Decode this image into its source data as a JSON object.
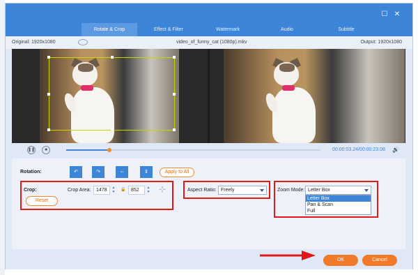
{
  "tabs": [
    "Rotate & Crop",
    "Effect & Filter",
    "Watermark",
    "Audio",
    "Subtitle"
  ],
  "window": {
    "minimize_icon": "square-icon",
    "close_icon": "close-icon"
  },
  "info": {
    "original": "Original: 1920x1080",
    "filename": "video_of_funny_cat (1080p).mkv",
    "output": "Output: 1920x1080"
  },
  "player": {
    "time": "00:00:03.24/00:00:23.08",
    "progress_fraction": 0.17
  },
  "rotation": {
    "label": "Rotation:",
    "apply_all": "Apply to All",
    "buttons": [
      "rotate-left-icon",
      "rotate-right-icon",
      "flip-horizontal-icon",
      "flip-vertical-icon"
    ]
  },
  "crop": {
    "label": "Crop:",
    "area_label": "Crop Area:",
    "width": "1478",
    "height": "852",
    "reset": "Reset"
  },
  "aspect": {
    "label": "Aspect Ratio:",
    "value": "Freely"
  },
  "zoom": {
    "label": "Zoom Mode:",
    "value": "Letter Box",
    "options": [
      "Letter Box",
      "Pan & Scan",
      "Full"
    ]
  },
  "footer": {
    "ok": "OK",
    "cancel": "Cancel"
  },
  "colors": {
    "accent": "#3d85d8",
    "orange": "#f07a2a",
    "highlight": "#e01818"
  }
}
